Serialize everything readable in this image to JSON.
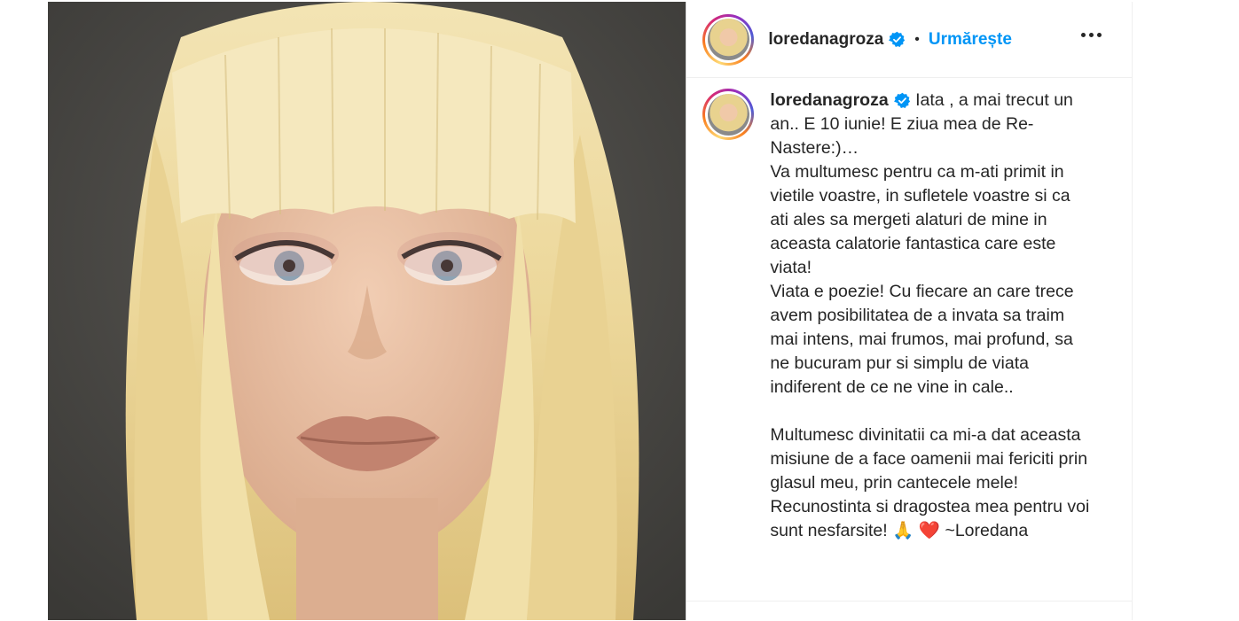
{
  "post": {
    "author": {
      "username": "loredanagroza",
      "verified": true,
      "avatar_icon": "profile-avatar"
    },
    "header": {
      "separator": "•",
      "follow_label": "Urmărește",
      "more_icon": "more-options-icon"
    },
    "caption": {
      "username": "loredanagroza",
      "text": "Iata , a mai trecut un an.. E 10 iunie! E ziua mea de Re-Nastere:)…\nVa multumesc pentru ca m-ati primit in vietile voastre, in sufletele voastre si ca ati ales sa mergeti alaturi de mine in aceasta calatorie fantastica care este viata!\nViata e poezie! Cu fiecare an care trece avem posibilitatea de a invata sa traim mai intens, mai frumos, mai profund, sa ne bucuram pur si simplu de viata indiferent de ce ne vine in cale..\n\nMultumesc divinitatii ca mi-a dat aceasta misiune de a face oamenii mai fericiti prin glasul meu, prin cantecele mele!\nRecunostinta si dragostea mea pentru voi sunt nesfarsite! 🙏 ❤️ ~Loredana"
    },
    "colors": {
      "accent": "#0095f6",
      "text": "#262626",
      "verified": "#0095f6"
    }
  }
}
